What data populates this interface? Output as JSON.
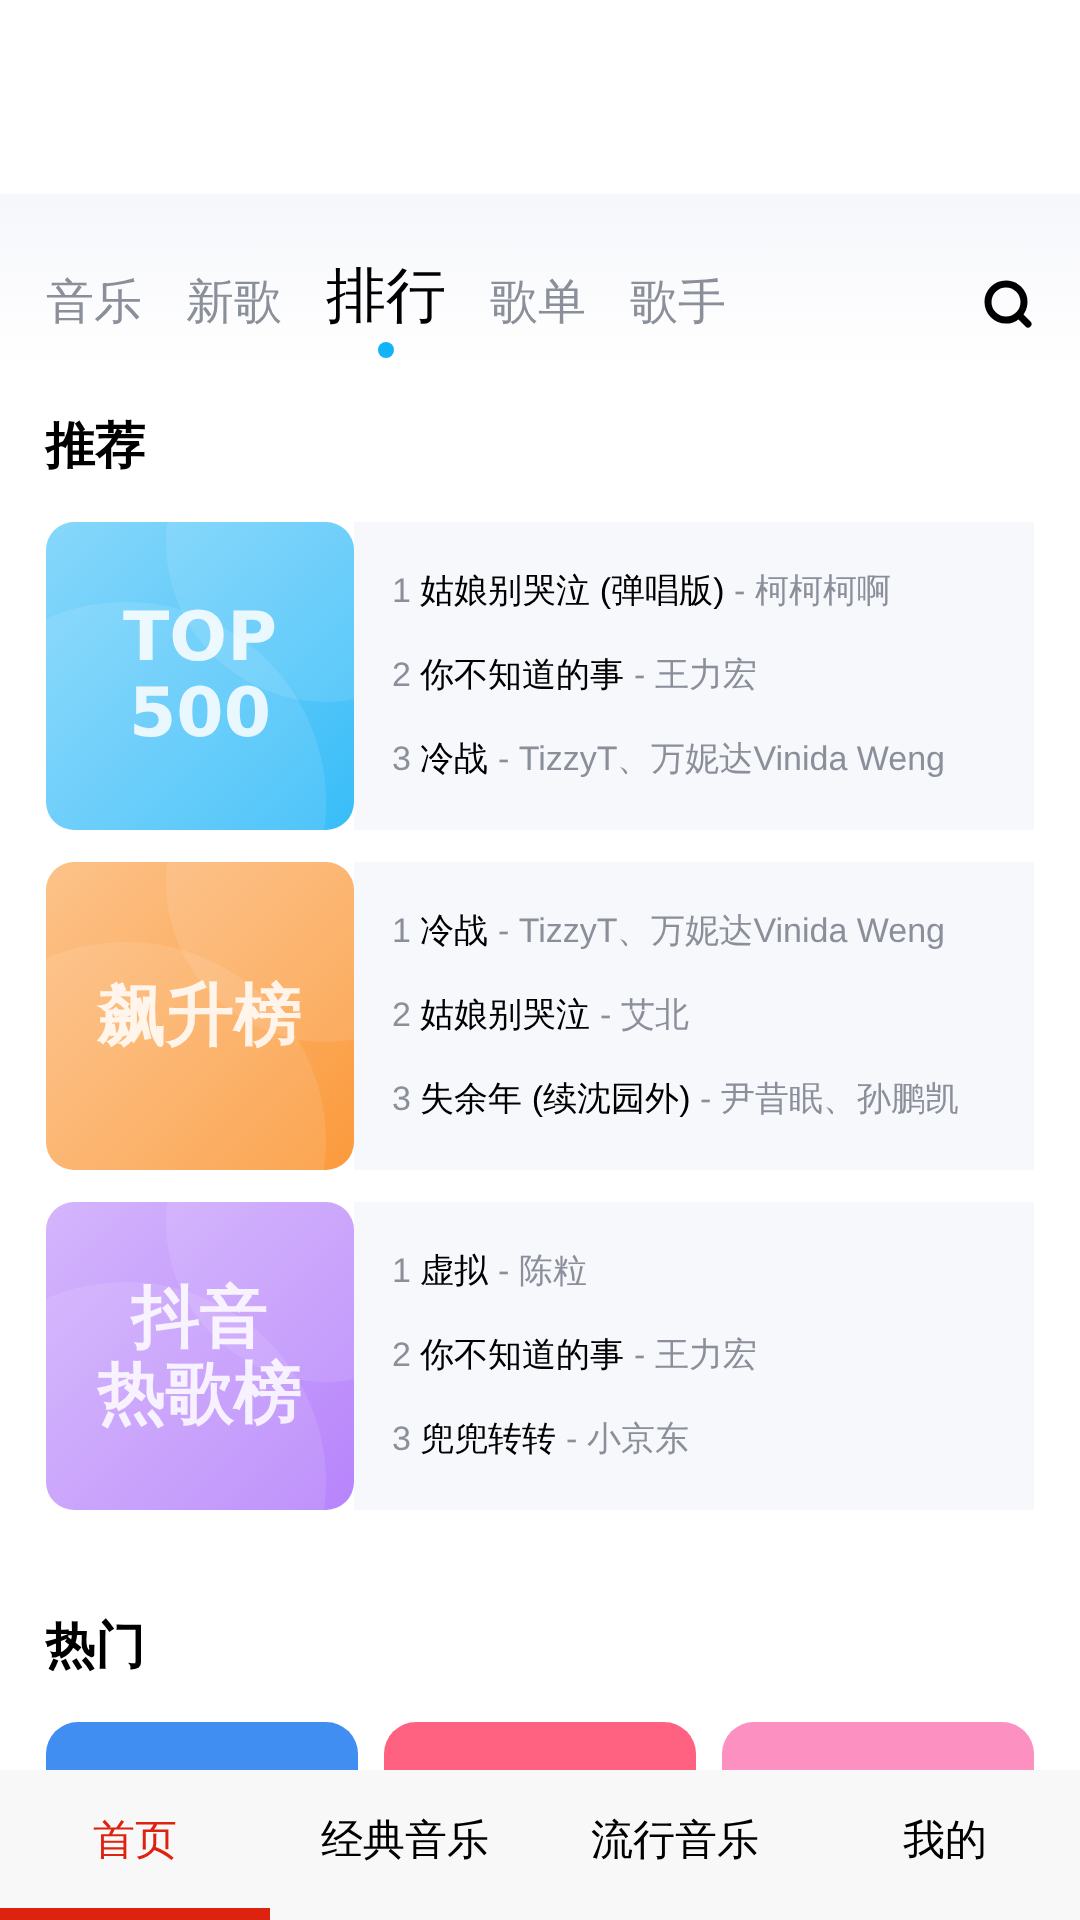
{
  "tabs": [
    {
      "label": "音乐",
      "selected": false
    },
    {
      "label": "新歌",
      "selected": false
    },
    {
      "label": "排行",
      "selected": true
    },
    {
      "label": "歌单",
      "selected": false
    },
    {
      "label": "歌手",
      "selected": false
    }
  ],
  "recommend": {
    "title": "推荐",
    "charts": [
      {
        "cover_lines": [
          "TOP",
          "500"
        ],
        "color": "#38bdf8",
        "songs": [
          {
            "rank": "1",
            "title": "姑娘别哭泣 (弹唱版)",
            "artist": "- 柯柯柯啊"
          },
          {
            "rank": "2",
            "title": "你不知道的事",
            "artist": "- 王力宏"
          },
          {
            "rank": "3",
            "title": "冷战",
            "artist": "- TizzyT、万妮达Vinida Weng"
          }
        ]
      },
      {
        "cover_lines": [
          "飙升榜"
        ],
        "color": "#fb9a3c",
        "songs": [
          {
            "rank": "1",
            "title": "冷战",
            "artist": "- TizzyT、万妮达Vinida Weng"
          },
          {
            "rank": "2",
            "title": "姑娘别哭泣",
            "artist": "- 艾北"
          },
          {
            "rank": "3",
            "title": "失余年 (续沈园外)",
            "artist": "- 尹昔眠、孙鹏凯"
          }
        ]
      },
      {
        "cover_lines": [
          "抖音",
          "热歌榜"
        ],
        "color": "#b784fb",
        "songs": [
          {
            "rank": "1",
            "title": "虚拟",
            "artist": "- 陈粒"
          },
          {
            "rank": "2",
            "title": "你不知道的事",
            "artist": "- 王力宏"
          },
          {
            "rank": "3",
            "title": "兜兜转转",
            "artist": "- 小京东"
          }
        ]
      }
    ]
  },
  "hot": {
    "title": "热门",
    "cards": [
      {
        "color": "#418ef2"
      },
      {
        "color": "#ff6180"
      },
      {
        "color": "#fc90c0"
      }
    ]
  },
  "bottom_nav": [
    {
      "label": "首页",
      "selected": true
    },
    {
      "label": "经典音乐",
      "selected": false
    },
    {
      "label": "流行音乐",
      "selected": false
    },
    {
      "label": "我的",
      "selected": false
    }
  ]
}
